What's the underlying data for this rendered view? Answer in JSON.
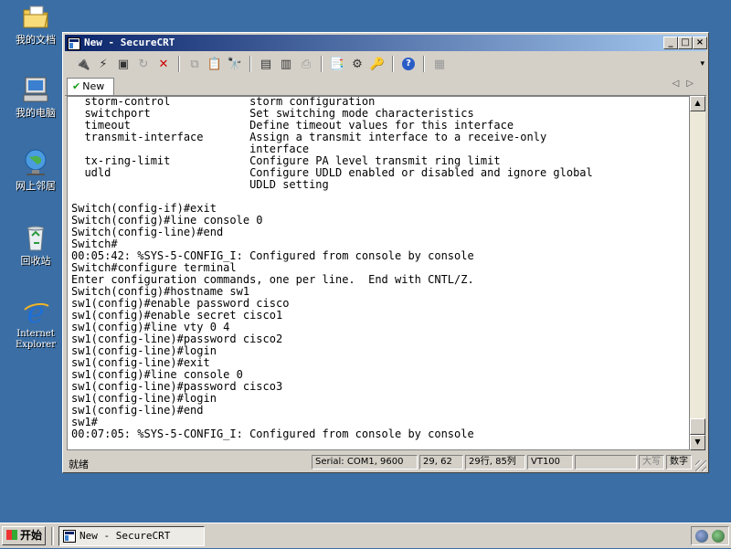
{
  "desktop": {
    "icons": [
      {
        "label": "我的文档",
        "icon": "my-documents-icon"
      },
      {
        "label": "我的电脑",
        "icon": "my-computer-icon"
      },
      {
        "label": "网上邻居",
        "icon": "network-places-icon"
      },
      {
        "label": "回收站",
        "icon": "recycle-bin-icon"
      },
      {
        "label": "Internet\nExplorer",
        "icon": "internet-explorer-icon"
      }
    ]
  },
  "window": {
    "title": "New - SecureCRT",
    "controls": {
      "minimize": "_",
      "maximize": "□",
      "close": "×"
    },
    "tab": {
      "label": "New",
      "status_icon": "checkmark-icon"
    },
    "tab_scroll_left": "◁",
    "tab_scroll_right": "▷",
    "scroll_up": "▲",
    "scroll_down": "▼",
    "terminal_lines": [
      "  storm-control            storm configuration",
      "  switchport               Set switching mode characteristics",
      "  timeout                  Define timeout values for this interface",
      "  transmit-interface       Assign a transmit interface to a receive-only",
      "                           interface",
      "  tx-ring-limit            Configure PA level transmit ring limit",
      "  udld                     Configure UDLD enabled or disabled and ignore global",
      "                           UDLD setting",
      "",
      "Switch(config-if)#exit",
      "Switch(config)#line console 0",
      "Switch(config-line)#end",
      "Switch#",
      "00:05:42: %SYS-5-CONFIG_I: Configured from console by console",
      "Switch#configure terminal",
      "Enter configuration commands, one per line.  End with CNTL/Z.",
      "Switch(config)#hostname sw1",
      "sw1(config)#enable password cisco",
      "sw1(config)#enable secret cisco1",
      "sw1(config)#line vty 0 4",
      "sw1(config-line)#password cisco2",
      "sw1(config-line)#login",
      "sw1(config-line)#exit",
      "sw1(config)#line console 0",
      "sw1(config-line)#password cisco3",
      "sw1(config-line)#login",
      "sw1(config-line)#end",
      "sw1#",
      "00:07:05: %SYS-5-CONFIG_I: Configured from console by console"
    ],
    "status": {
      "ready": "就绪",
      "serial": "Serial: COM1, 9600",
      "cursor": "29, 62",
      "size": "29行, 85列",
      "terminal_type": "VT100",
      "caps": "大写",
      "num": "数字"
    }
  },
  "taskbar": {
    "start_label": "开始",
    "task_label": "New - SecureCRT"
  }
}
